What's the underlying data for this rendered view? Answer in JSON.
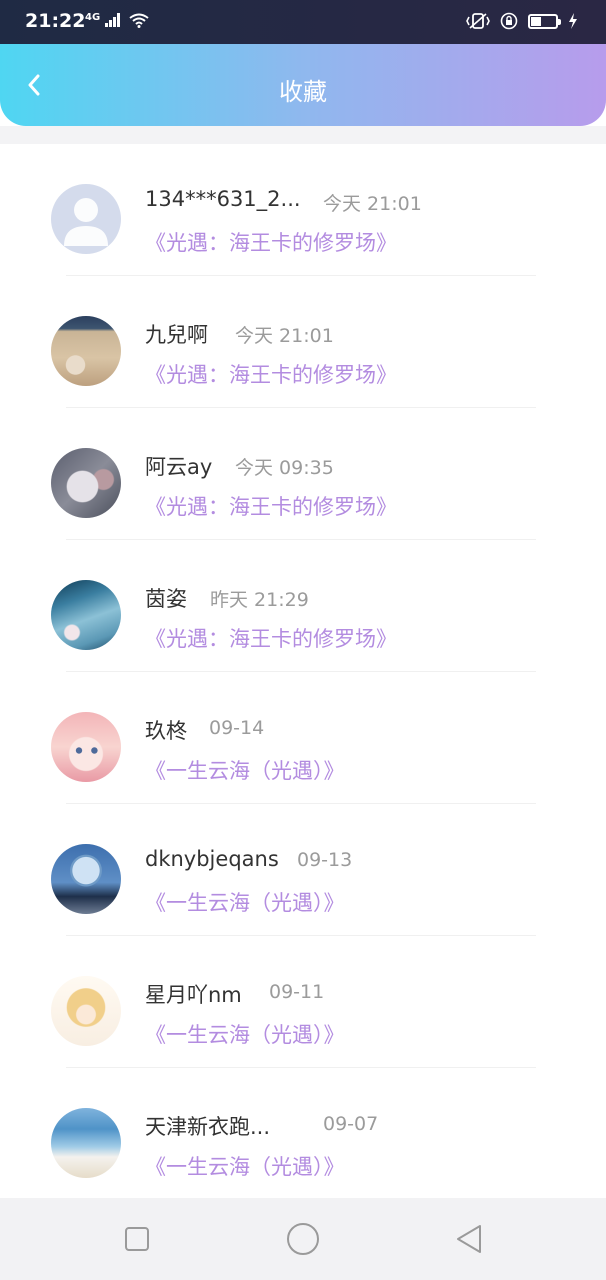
{
  "status": {
    "time": "21:22",
    "network": "4G"
  },
  "header": {
    "title": "收藏",
    "back_icon": "chevron-left-icon"
  },
  "favorites": [
    {
      "name": "134***631_2...",
      "time": "今天 21:01",
      "title": "《光遇：海王卡的修罗场》",
      "avatar": "default-person"
    },
    {
      "name": "九兒啊",
      "time": "今天 21:01",
      "title": "《光遇：海王卡的修罗场》",
      "avatar": "beach-shell"
    },
    {
      "name": "阿云ay",
      "time": "今天 09:35",
      "title": "《光遇：海王卡的修罗场》",
      "avatar": "bird"
    },
    {
      "name": "茵姿",
      "time": "昨天 21:29",
      "title": "《光遇：海王卡的修罗场》",
      "avatar": "sea-water"
    },
    {
      "name": "玖柊",
      "time": "09-14",
      "title": "《一生云海（光遇）》",
      "avatar": "anime-girl-pink"
    },
    {
      "name": "dknybjeqans",
      "time": "09-13",
      "title": "《一生云海（光遇）》",
      "avatar": "snow-globe"
    },
    {
      "name": "星月吖nm",
      "time": "09-11",
      "title": "《一生云海（光遇）》",
      "avatar": "anime-girl-gold"
    },
    {
      "name": "天津新衣跑...",
      "time": "09-07",
      "title": "《一生云海（光遇）》",
      "avatar": "ocean-beach"
    }
  ],
  "system_nav": {
    "recent_icon": "square-icon",
    "home_icon": "circle-icon",
    "back_icon": "triangle-back-icon"
  },
  "colors": {
    "title_purple": "#b38ce0",
    "header_gradient_start": "#4fd6f2",
    "header_gradient_end": "#b79cec"
  }
}
